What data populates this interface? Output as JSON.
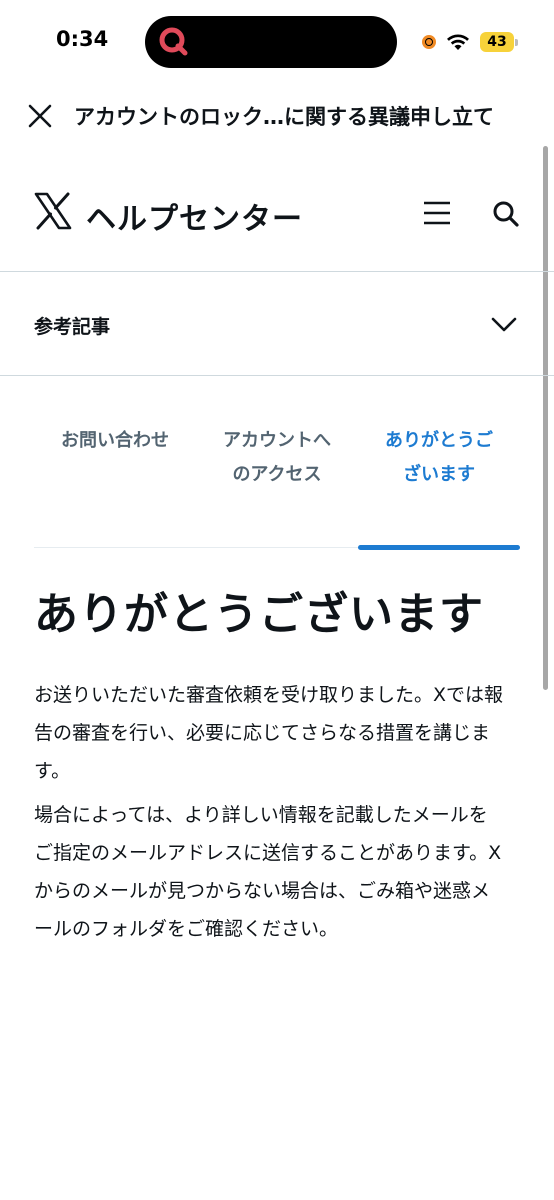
{
  "status_bar": {
    "time": "0:34",
    "battery_level": "43",
    "battery_color": "#f7d23a",
    "recording_indicator_color": "#f08a24"
  },
  "webview": {
    "title": "アカウントのロック…に関する異議申し立て"
  },
  "header": {
    "site_title": "ヘルプセンター",
    "logo_icon": "x-logo-icon",
    "menu_icon": "hamburger-menu-icon",
    "search_icon": "search-icon"
  },
  "related_articles": {
    "label": "参考記事"
  },
  "steps": [
    {
      "label": "お問い合わせ",
      "active": false
    },
    {
      "label": "アカウントへのアクセス",
      "active": false
    },
    {
      "label": "ありがとうございます",
      "active": true
    }
  ],
  "accent_color": "#1d7bd1",
  "content": {
    "heading": "ありがとうございます",
    "paragraph1": "お送りいただいた審査依頼を受け取りました。Xでは報告の審査を行い、必要に応じてさらなる措置を講じます。",
    "paragraph2": "場合によっては、より詳しい情報を記載したメールをご指定のメールアドレスに送信することがあります。Xからのメールが見つからない場合は、ごみ箱や迷惑メールのフォルダをご確認ください。"
  }
}
